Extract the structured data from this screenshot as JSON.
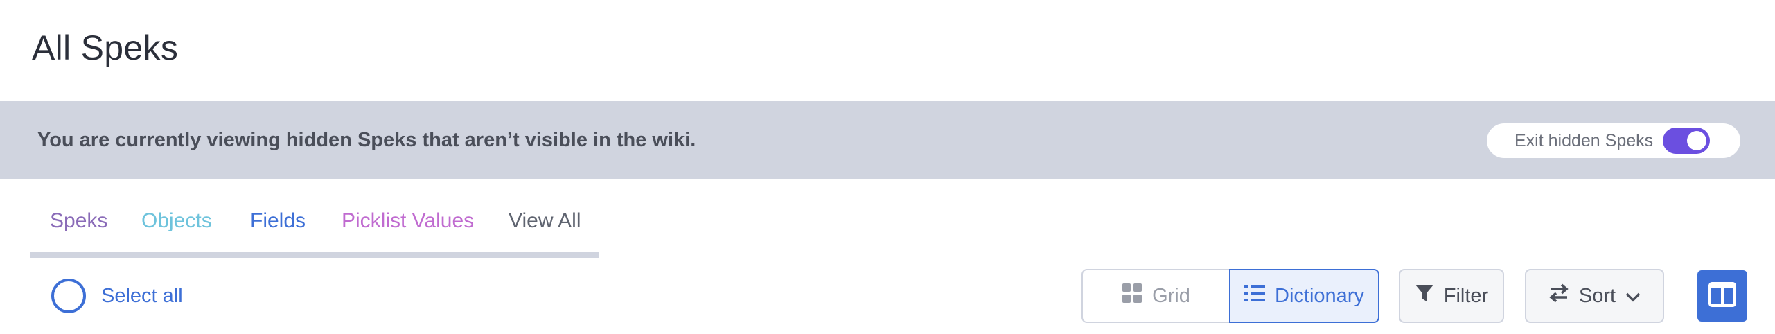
{
  "page": {
    "title": "All Speks"
  },
  "banner": {
    "message": "You are currently viewing hidden Speks that aren’t visible in the wiki.",
    "exit_label": "Exit hidden Speks",
    "toggle_on": true
  },
  "tabs": [
    {
      "label": "Speks",
      "color": "#8a6bb8"
    },
    {
      "label": "Objects",
      "color": "#6ec3dc"
    },
    {
      "label": "Fields",
      "color": "#3d6fd6"
    },
    {
      "label": "Picklist Values",
      "color": "#c06bd0"
    },
    {
      "label": "View All",
      "color": "#5f6470"
    }
  ],
  "toolbar": {
    "select_all_label": "Select all",
    "grid_label": "Grid",
    "dictionary_label": "Dictionary",
    "active_view": "Dictionary",
    "filter_label": "Filter",
    "sort_label": "Sort"
  },
  "icons": {
    "grid": "grid-icon",
    "dictionary": "list-icon",
    "filter": "funnel-icon",
    "sort": "swap-arrows-icon",
    "sort_dropdown": "chevron-down-icon",
    "layout": "split-columns-icon"
  },
  "colors": {
    "accent": "#3d6fd6",
    "toggle": "#6b4fe0",
    "banner_bg": "#d0d4df"
  }
}
